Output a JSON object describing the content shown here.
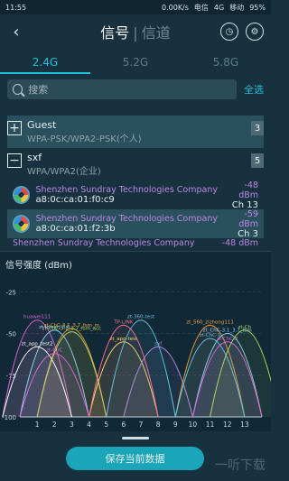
{
  "status": {
    "time": "11:55",
    "speed": "0.00K/s",
    "carrier1": "电信",
    "net1": "4G",
    "carrier2": "移动",
    "battery": "95%"
  },
  "header": {
    "title": "信号",
    "divider": "|",
    "subtitle": "信道"
  },
  "tabs": [
    {
      "label": "2.4G"
    },
    {
      "label": "5.2G"
    },
    {
      "label": "5.8G"
    }
  ],
  "search": {
    "placeholder": "搜索",
    "select_all": "全选"
  },
  "list": {
    "cut_text": "",
    "groups": [
      {
        "name": "Guest",
        "security": "WPA-PSK/WPA2-PSK(个人)",
        "count": "3",
        "toggle": "+"
      },
      {
        "name": "sxf",
        "security": "WPA/WPA2(企业)",
        "count": "5",
        "toggle": "−"
      }
    ],
    "aps": [
      {
        "name": "Shenzhen Sundray Technologies Company",
        "mac": "a8:0c:ca:01:f0:c9",
        "dbm": "-48 dBm",
        "ch": "Ch 13"
      },
      {
        "name": "Shenzhen Sundray Technologies Company",
        "mac": "a8:0c:ca:01:f2:3b",
        "dbm": "-59 dBm",
        "ch": "Ch 3"
      },
      {
        "name": "Shenzhen Sundray Technologies Company",
        "dbm": "-48 dBm"
      }
    ]
  },
  "chart_data": {
    "type": "area",
    "title": "信号强度 (dBm)",
    "x_ticks": [
      1,
      2,
      3,
      4,
      5,
      6,
      7,
      8,
      9,
      10,
      11,
      12,
      13
    ],
    "y_ticks": [
      -25,
      -50,
      -75,
      -100
    ],
    "ylim": [
      -100,
      -20
    ],
    "xlim": [
      0,
      14
    ],
    "series": [
      {
        "name": "huawei111",
        "channel": 1,
        "dbm": -42,
        "color": "#e063d6"
      },
      {
        "name": "zt-lowerj-3.6",
        "channel": 2,
        "dbm": -48,
        "color": "#8fd0f0"
      },
      {
        "name": "zt-ChC-3.1_3.7_fsm_m",
        "channel": 3,
        "dbm": -47,
        "color": "#e89f3a"
      },
      {
        "name": "zt-ChC-3.1_3.7_fsm_acc",
        "channel": 3,
        "dbm": -49,
        "color": "#b0d85a"
      },
      {
        "name": "zt_app-test",
        "channel": 6,
        "dbm": -55,
        "color": "#f2e45c"
      },
      {
        "name": "sxf",
        "channel": 8,
        "dbm": -58,
        "color": "#b888e0"
      },
      {
        "name": "zt-360-test",
        "channel": 7,
        "dbm": -42,
        "color": "#5fc7e0"
      },
      {
        "name": "TP-LINK",
        "channel": 6,
        "dbm": -45,
        "color": "#ff6f91"
      },
      {
        "name": "zt_560_zizhong111",
        "channel": 11,
        "dbm": -45,
        "color": "#e89f3a"
      },
      {
        "name": "zt_ChC-3.1_3.7_fsm",
        "channel": 12,
        "dbm": -50,
        "color": "#8fd0f0"
      },
      {
        "name": "zt-ChC-1",
        "channel": 11,
        "dbm": -53,
        "color": "#5fc7e0"
      },
      {
        "name": "zt-ChC-2",
        "channel": 12,
        "dbm": -55,
        "color": "#e063d6"
      },
      {
        "name": "zt-Ch",
        "channel": 13,
        "dbm": -48,
        "color": "#b0d85a"
      },
      {
        "name": "zt-ChC",
        "channel": 2,
        "dbm": -62,
        "color": "#e063d6"
      },
      {
        "name": "zt_app_test2",
        "channel": 1,
        "dbm": -58,
        "color": "#ffffff"
      }
    ]
  },
  "actions": {
    "save_label": "保存当前数据"
  },
  "watermark": "一听下载"
}
